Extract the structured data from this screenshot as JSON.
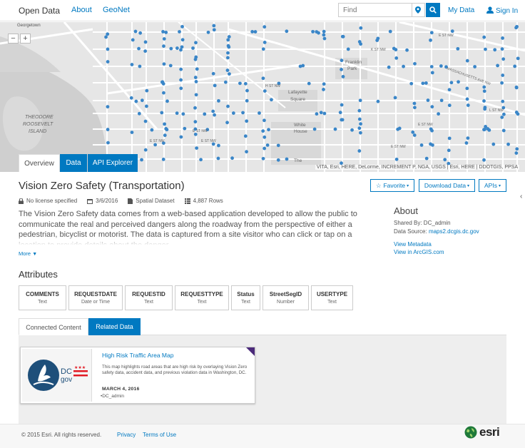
{
  "nav": {
    "brand": "Open Data",
    "links": [
      "About",
      "GeoNet"
    ],
    "search_placeholder": "Find",
    "my_data": "My Data",
    "sign_in": "Sign In"
  },
  "map": {
    "zoom_in": "+",
    "zoom_out": "−",
    "attribution": "VITA, Esri, HERE, DeLorme, INCREMENT P, NGA, USGS | Esri, HERE | DDOTGIS, PPSA",
    "place_labels": {
      "georgetown": "Georgetown",
      "theodore_1": "THEODORE",
      "theodore_2": "ROOSEVELT",
      "theodore_3": "ISLAND",
      "lafayette_1": "Lafayette",
      "lafayette_2": "Square",
      "whitehouse_1": "White",
      "whitehouse_2": "House",
      "franklin_1": "Franklin",
      "franklin_2": "Park",
      "the": "The"
    },
    "street_labels": {
      "s1": "E ST NW",
      "s2": "H ST NW",
      "s3": "K ST NW",
      "s4": "E ST NW",
      "s5": "MASSACHUSETTS AVE NW",
      "s6": "E ST NW",
      "s7": "E ST NW",
      "s8": "E ST NW",
      "s9": "E ST NW",
      "s10": "L ST NW"
    },
    "colors": {
      "dot": "#3a86c8",
      "road": "#ffffff",
      "park": "#d7d7d7"
    }
  },
  "map_tabs": [
    "Overview",
    "Data",
    "API Explorer"
  ],
  "dataset": {
    "title": "Vision Zero Safety (Transportation)",
    "license": "No license specified",
    "date": "3/6/2016",
    "type": "Spatial Dataset",
    "rows": "4,887 Rows",
    "description": "The Vision Zero Safety data comes from a web-based application developed to allow the public to communicate the real and perceived dangers along the roadway from the perspective of either a pedestrian, bicyclist or motorist. The data is captured from a site visitor who can click or tap on a location to provide details about the danger...",
    "more": "More"
  },
  "actions": {
    "favorite": "Favorite",
    "download": "Download Data",
    "apis": "APIs"
  },
  "about": {
    "heading": "About",
    "shared_by": "Shared By: DC_admin",
    "source_label": "Data Source:",
    "source_value": "maps2.dcgis.dc.gov",
    "view_metadata": "View Metadata",
    "view_arcgis": "View in ArcGIS.com"
  },
  "attributes": {
    "heading": "Attributes",
    "items": [
      {
        "name": "COMMENTS",
        "type": "Text"
      },
      {
        "name": "REQUESTDATE",
        "type": "Date or Time"
      },
      {
        "name": "REQUESTID",
        "type": "Text"
      },
      {
        "name": "REQUESTTYPE",
        "type": "Text"
      },
      {
        "name": "Status",
        "type": "Text"
      },
      {
        "name": "StreetSegID",
        "type": "Number"
      },
      {
        "name": "USERTYPE",
        "type": "Text"
      }
    ]
  },
  "content_tabs": [
    "Connected Content",
    "Related Data"
  ],
  "related_card": {
    "title": "High Risk Traffic Area Map",
    "description": "This map highlights road areas that are high risk by overlaying Vision Zero safety data, accident data, and previous violation data in Washington, DC.",
    "date": "MARCH 4, 2016",
    "owner": "DC_admin",
    "logo_text_1": "DC",
    "logo_text_2": "gov"
  },
  "footer": {
    "copyright": "© 2015 Esri. All rights reserved.",
    "privacy": "Privacy",
    "terms": "Terms of Use",
    "esri": "esri"
  }
}
